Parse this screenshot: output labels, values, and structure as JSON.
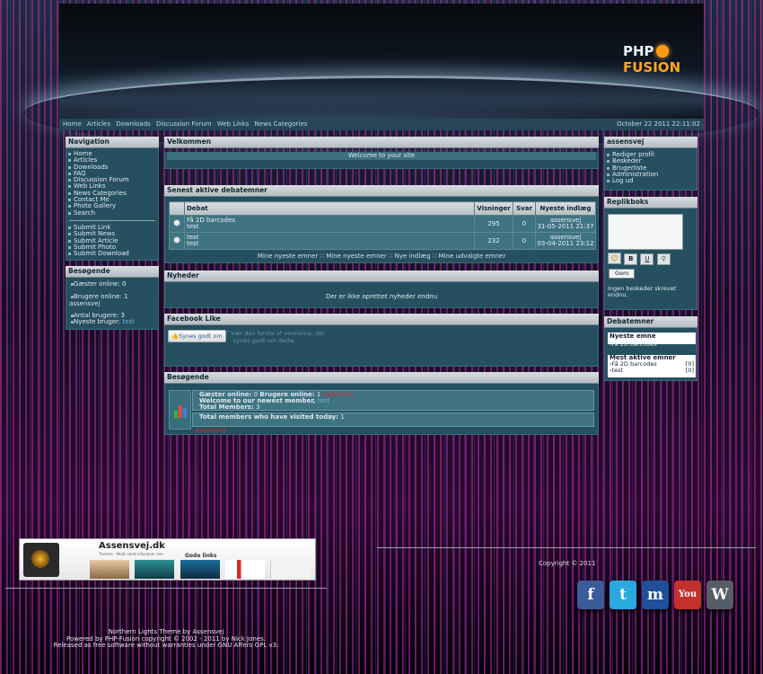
{
  "banner": {
    "logo_text_1": "PHP",
    "logo_text_2": "FUSION"
  },
  "topnav": {
    "links": [
      "Home",
      "Articles",
      "Downloads",
      "Discussion Forum",
      "Web Links",
      "News Categories"
    ],
    "datetime": "October 22 2011 22:11:02"
  },
  "left": {
    "navigation": {
      "title": "Navigation",
      "group1": [
        "Home",
        "Articles",
        "Downloads",
        "FAQ",
        "Discussion Forum",
        "Web Links",
        "News Categories",
        "Contact Me",
        "Photo Gallery",
        "Search"
      ],
      "group2": [
        "Submit Link",
        "Submit News",
        "Submit Article",
        "Submit Photo",
        "Submit Download"
      ]
    },
    "visitors": {
      "title": "Besøgende",
      "guests": "Gæster online: 0",
      "users_online": "Brugere online: 1",
      "user": "assensvej",
      "total_label": "Antal brugere: 3",
      "newest_label": "Nyeste bruger:",
      "newest_user": "test"
    }
  },
  "center": {
    "welcome": {
      "title": "Velkommen",
      "text": "Welcome to your site"
    },
    "threads": {
      "title": "Senest aktive debatemner",
      "headers": [
        "Debat",
        "Visninger",
        "Svar",
        "Nyeste indlæg"
      ],
      "rows": [
        {
          "topic": "Få 2D barcodes",
          "by": "test",
          "views": "295",
          "replies": "0",
          "last_user": "assensvej",
          "last_date": "31-05-2011 21:37"
        },
        {
          "topic": "test",
          "by": "test",
          "views": "232",
          "replies": "0",
          "last_user": "assensvej",
          "last_date": "03-04-2011 23:12"
        }
      ],
      "links": [
        "Mine nyeste emner",
        "Mine nyeste emner",
        "Nye indlæg",
        "Mine udvalgte emner"
      ]
    },
    "news": {
      "title": "Nyheder",
      "text": "Der er ikke oprettet nyheder endnu"
    },
    "facebook": {
      "title": "Facebook Like",
      "button": "Synes godt om",
      "text1": "Vær den første af vennerne, der",
      "text2": "synes godt om dette."
    },
    "visitors": {
      "title": "Besøgende",
      "guests": "Gæster online:",
      "guests_val": "0",
      "users": "Brugere online:",
      "users_val": "1",
      "users_name": "assensvej",
      "newest": "Welcome to our newest member,",
      "newest_name": "test",
      "total": "Total Members:",
      "total_val": "3",
      "today": "Total members who have visited today:",
      "today_val": "1",
      "today_name": "assensvej"
    }
  },
  "right": {
    "user": {
      "title": "assensvej",
      "links": [
        "Rediger profil",
        "Beskeder",
        "Brugerliste",
        "Administration",
        "Log ud"
      ]
    },
    "shoutbox": {
      "title": "Replikboks",
      "save": "Gem",
      "empty": "Ingen beskeder skrevet endnu.",
      "tools": [
        "☺",
        "B",
        "U",
        "⚲"
      ]
    },
    "topics": {
      "title": "Debatemner",
      "newest_label": "Nyeste emne",
      "newest_items": [
        "Få 2D barcodes"
      ],
      "active_label": "Mest aktive emner",
      "active_items": [
        {
          "name": "Få 2D barcodes",
          "count": "[0]"
        },
        {
          "name": "test",
          "count": "[0]"
        }
      ]
    }
  },
  "footer": {
    "promo_title": "Assensvej.dk",
    "promo_sub": "Themes - Mods samt infusioner mm.",
    "promo_links": "Gode links",
    "copyright": "Copyright © 2011",
    "credits1": "Northern Lights Theme by Assensvej",
    "credits2": "Powered by PHP-Fusion copyright © 2002 - 2011 by Nick Jones.",
    "credits3": "Released as free software without warranties under GNU Affero GPL v3.",
    "social": [
      {
        "name": "facebook-icon",
        "glyph": "f",
        "color": "#3b5b99"
      },
      {
        "name": "twitter-icon",
        "glyph": "t",
        "color": "#2aa9e0"
      },
      {
        "name": "myspace-icon",
        "glyph": "m",
        "color": "#1f4f9a"
      },
      {
        "name": "youtube-icon",
        "glyph": "You",
        "color": "#c4302b"
      },
      {
        "name": "wordpress-icon",
        "glyph": "W",
        "color": "#555d66"
      }
    ]
  }
}
